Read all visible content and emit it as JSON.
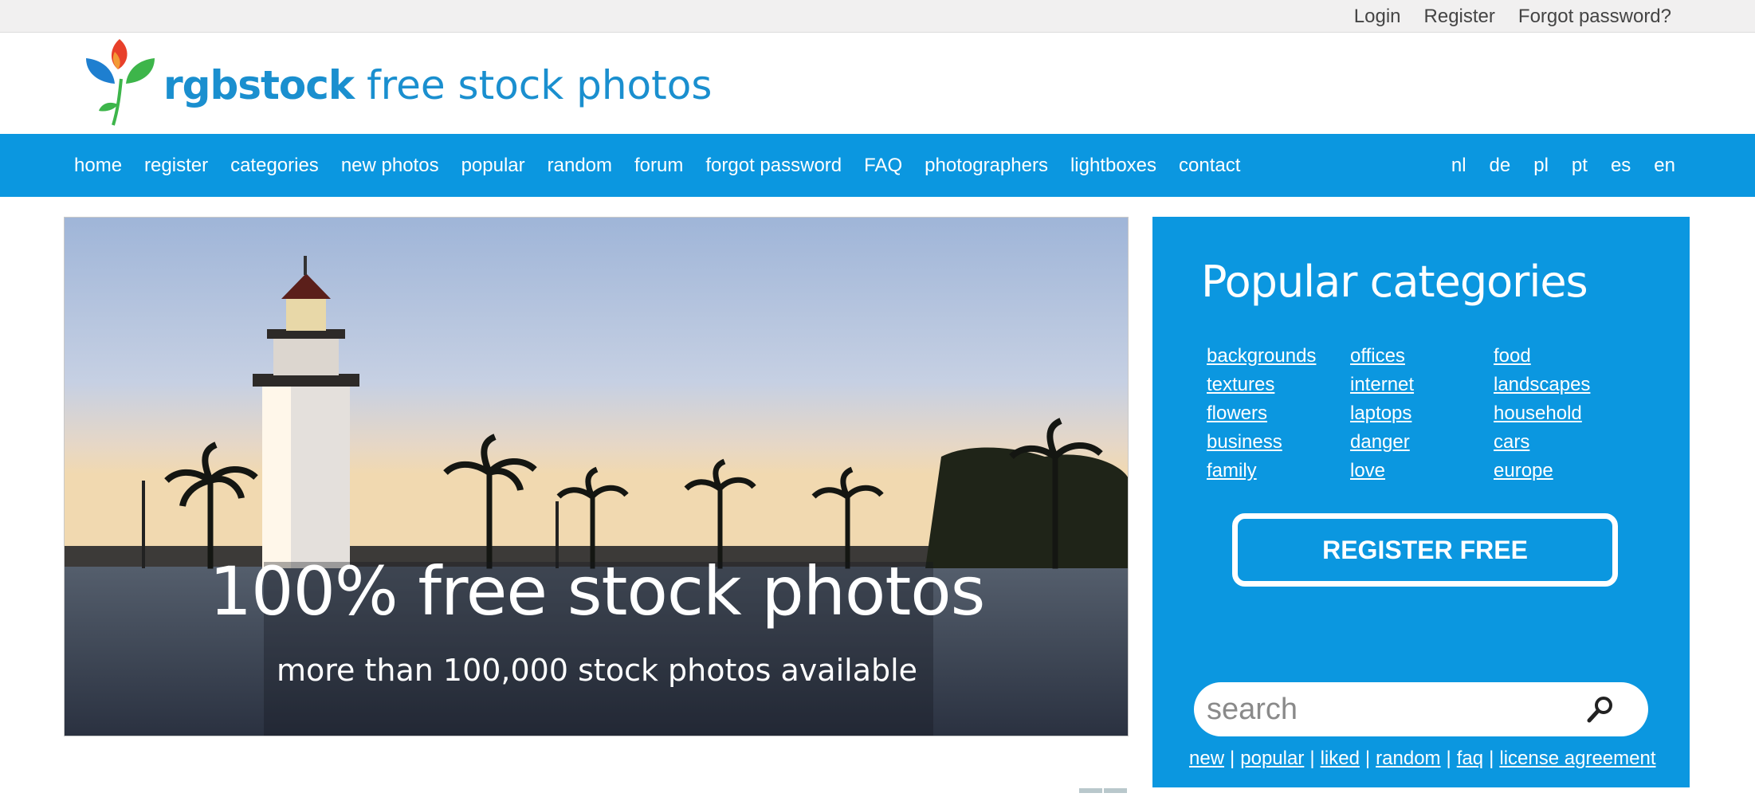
{
  "topbar": {
    "links": [
      "Login",
      "Register",
      "Forgot password?"
    ]
  },
  "logo": {
    "brand": "rgbstock",
    "tagline": "free stock photos",
    "icon": "flower-logo-icon"
  },
  "nav": {
    "items": [
      "home",
      "register",
      "categories",
      "new photos",
      "popular",
      "random",
      "forum",
      "forgot password",
      "FAQ",
      "photographers",
      "lightboxes",
      "contact"
    ],
    "languages": [
      "nl",
      "de",
      "pl",
      "pt",
      "es",
      "en"
    ]
  },
  "hero": {
    "title": "100% free stock photos",
    "subtitle": "more than 100,000 stock photos available"
  },
  "sidebar": {
    "title": "Popular categories",
    "categories": [
      "backgrounds",
      "offices",
      "food",
      "textures",
      "internet",
      "landscapes",
      "flowers",
      "laptops",
      "household",
      "business",
      "danger",
      "cars",
      "family",
      "love",
      "europe"
    ],
    "register_label": "REGISTER FREE",
    "search_placeholder": "search",
    "bottom_links": [
      "new",
      "popular",
      "liked",
      "random",
      "faq",
      "license agreement"
    ]
  },
  "colors": {
    "brand_blue": "#0b97e0",
    "logo_blue": "#1a8fcf",
    "topbar_bg": "#f1f0f0"
  }
}
